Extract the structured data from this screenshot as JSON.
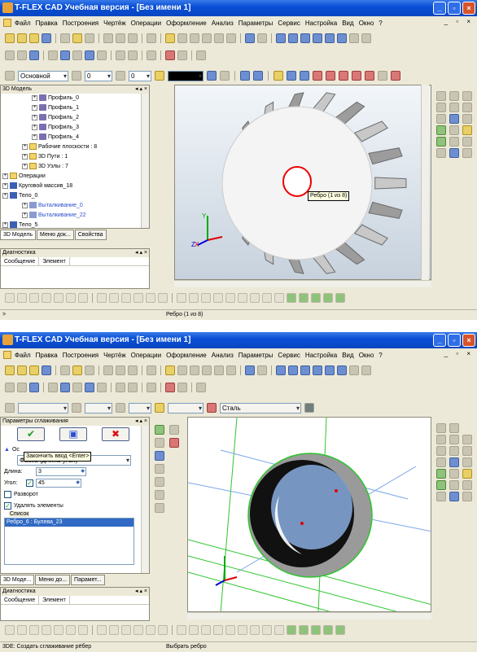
{
  "window1": {
    "title": "T-FLEX CAD Учебная версия - [Без имени 1]",
    "menu": [
      "Файл",
      "Правка",
      "Построения",
      "Чертёж",
      "Операции",
      "Оформление",
      "Анализ",
      "Параметры",
      "Сервис",
      "Настройка",
      "Вид",
      "Окно",
      "?"
    ],
    "mdi_controls": "_ ▫ ×",
    "propbar": {
      "layer": "Основной",
      "level": "0",
      "priority": "0"
    },
    "model_panel_title": "3D Модель",
    "tree": [
      {
        "label": "Профиль_0",
        "indent": 3
      },
      {
        "label": "Профиль_1",
        "indent": 3
      },
      {
        "label": "Профиль_2",
        "indent": 3
      },
      {
        "label": "Профиль_3",
        "indent": 3
      },
      {
        "label": "Профиль_4",
        "indent": 3
      },
      {
        "label": "Рабочие плоскости : 8",
        "indent": 2
      },
      {
        "label": "3D Пути : 1",
        "indent": 2
      },
      {
        "label": "3D Узлы : 7",
        "indent": 2
      },
      {
        "label": "Операции",
        "indent": 0
      },
      {
        "label": "Круговой массив_18",
        "indent": 0
      },
      {
        "label": "Тело_0",
        "indent": 0
      },
      {
        "label": "Выталкивание_0",
        "indent": 2
      },
      {
        "label": "Выталкивание_22",
        "indent": 2
      },
      {
        "label": "Тело_5",
        "indent": 0
      }
    ],
    "tabs": [
      "3D Модель",
      "Меню док...",
      "Свойства"
    ],
    "diag_title": "Диагностика",
    "diag_cols": [
      "Сообщение",
      "Элемент"
    ],
    "viewport_tooltip": "Ребро (1 из 8)",
    "axis_labels": {
      "x": "X",
      "y": "Y",
      "z": "Z"
    },
    "status_left": ">",
    "status_center": "Ребро (1 из 8)"
  },
  "window2": {
    "title": "T-FLEX CAD Учебная версия - [Без имени 1]",
    "menu": [
      "Файл",
      "Правка",
      "Построения",
      "Чертёж",
      "Операции",
      "Оформление",
      "Анализ",
      "Параметры",
      "Сервис",
      "Настройка",
      "Вид",
      "Окно",
      "?"
    ],
    "mdi_controls": "_ ▫ ×",
    "material": "Сталь",
    "panel_title": "Параметры сглаживания",
    "tooltip": "Закончить ввод <Enter>",
    "section_label": "Ос",
    "chamfer_type": "Фаска (длина-угол)",
    "length_label": "Длина:",
    "length_value": "3",
    "angle_label": "Угол:",
    "angle_value": "45",
    "flip_label": "Разворот",
    "delete_label": "Удалять элементы",
    "list_label": "Список",
    "list_items": [
      "Ребро_6 : Булева_23"
    ],
    "tabs": [
      "3D Моде...",
      "Меню до...",
      "Парамет..."
    ],
    "diag_title": "Диагностика",
    "diag_cols": [
      "Сообщение",
      "Элемент"
    ],
    "status_left": "3DE: Создать сглаживание рёбер",
    "status_center": "Выбрать ребро"
  }
}
